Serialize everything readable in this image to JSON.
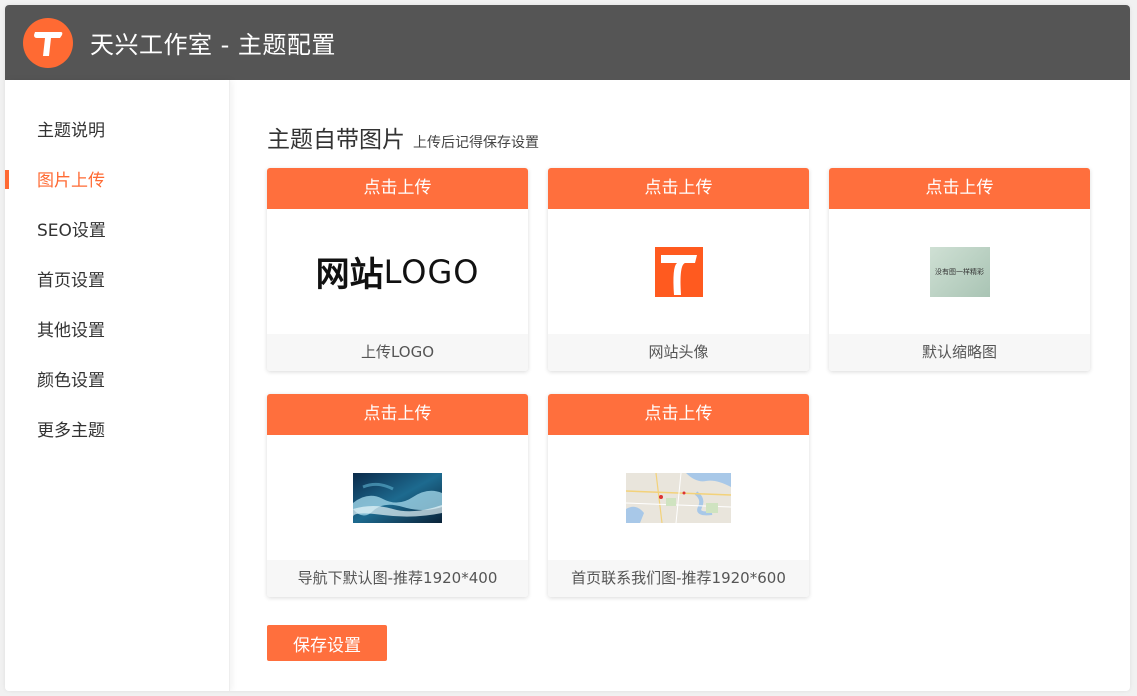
{
  "header": {
    "title": "天兴工作室 - 主题配置"
  },
  "sidebar": {
    "items": [
      {
        "label": "主题说明"
      },
      {
        "label": "图片上传"
      },
      {
        "label": "SEO设置"
      },
      {
        "label": "首页设置"
      },
      {
        "label": "其他设置"
      },
      {
        "label": "颜色设置"
      },
      {
        "label": "更多主题"
      }
    ],
    "active_index": 1
  },
  "main": {
    "title": "主题自带图片",
    "subtitle": "上传后记得保存设置",
    "cards": [
      {
        "button": "点击上传",
        "label": "上传LOGO",
        "logo_bold": "网站",
        "logo_light": "LOGO"
      },
      {
        "button": "点击上传",
        "label": "网站头像"
      },
      {
        "button": "点击上传",
        "label": "默认缩略图",
        "thumb_text": "没有图一样精彩"
      },
      {
        "button": "点击上传",
        "label": "导航下默认图-推荐1920*400"
      },
      {
        "button": "点击上传",
        "label": "首页联系我们图-推荐1920*600"
      }
    ],
    "save_label": "保存设置"
  },
  "colors": {
    "accent": "#ff6f3d",
    "header_bg": "#555555"
  }
}
